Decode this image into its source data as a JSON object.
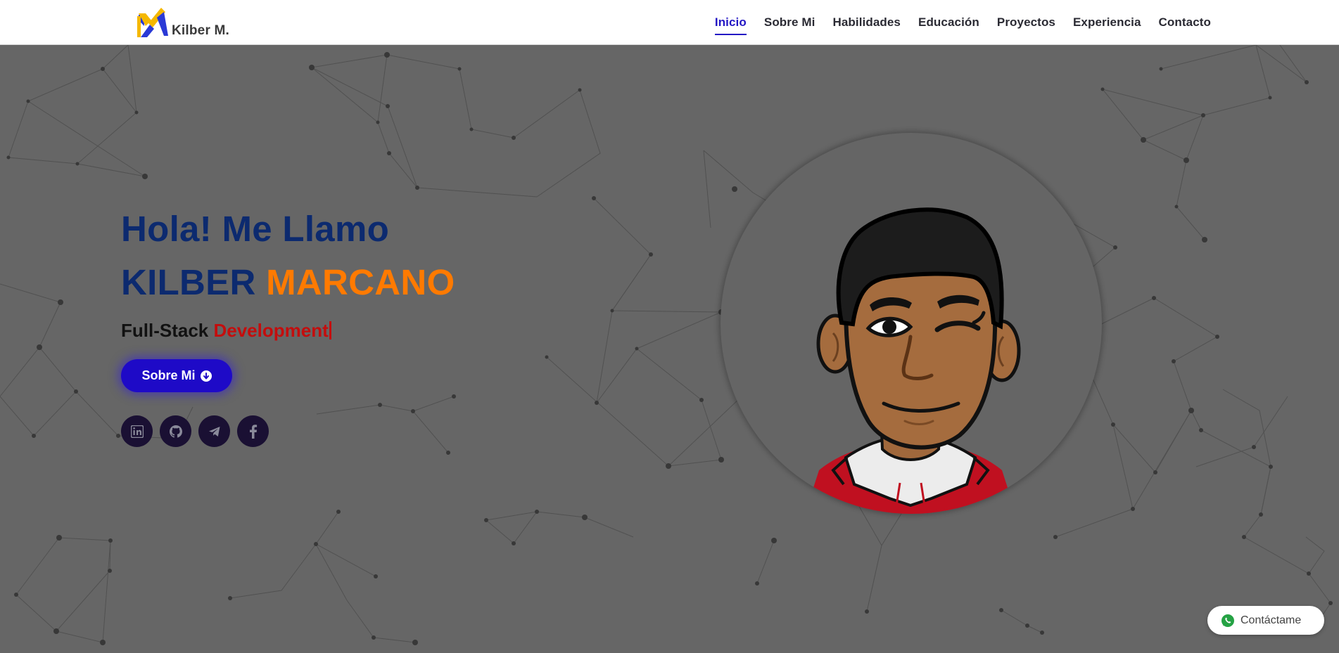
{
  "brand": {
    "name": "Kilber M.",
    "logo_icon": "km-logo-icon"
  },
  "nav": {
    "items": [
      {
        "label": "Inicio",
        "active": true
      },
      {
        "label": "Sobre Mi"
      },
      {
        "label": "Habilidades"
      },
      {
        "label": "Educación"
      },
      {
        "label": "Proyectos"
      },
      {
        "label": "Experiencia"
      },
      {
        "label": "Contacto"
      }
    ],
    "active_color": "#2317c4"
  },
  "hero": {
    "greeting": "Hola! Me Llamo",
    "first_name": "KILBER",
    "last_name": "MARCANO",
    "role_static": "Full-Stack",
    "role_typed": "Development",
    "cta_label": "Sobre Mi",
    "cta_icon": "arrow-down-circle-icon",
    "socials": [
      {
        "name": "linkedin",
        "icon": "linkedin-icon"
      },
      {
        "name": "github",
        "icon": "github-icon"
      },
      {
        "name": "telegram",
        "icon": "telegram-icon"
      },
      {
        "name": "facebook",
        "icon": "facebook-icon"
      }
    ]
  },
  "whatsapp": {
    "label": "Contáctame",
    "icon": "whatsapp-icon"
  },
  "colors": {
    "navy": "#0c2a6f",
    "orange": "#ff7a00",
    "red": "#c40d0d",
    "button": "#1e0ac7",
    "background": "#666666"
  }
}
